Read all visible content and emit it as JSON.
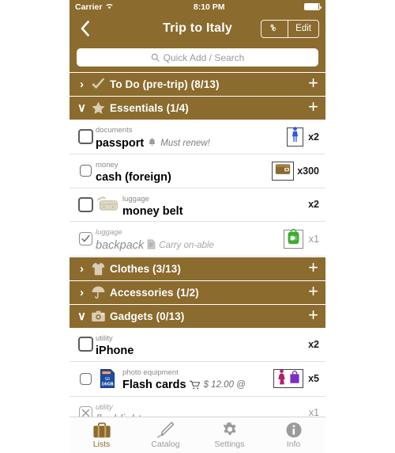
{
  "status_bar": {
    "carrier": "Carrier",
    "wifi_icon": "wifi-icon",
    "time": "8:10 PM",
    "battery_icon": "battery-icon"
  },
  "nav_bar": {
    "back_icon": "chevron-left-icon",
    "title": "Trip to Italy",
    "settings_icon": "gear-icon",
    "edit_label": "Edit"
  },
  "search": {
    "icon": "search-icon",
    "placeholder": "Quick Add / Search"
  },
  "colors": {
    "brand_brown": "#8B6B2E",
    "person_blue": "#2a5bd7",
    "woman_magenta": "#b51f6e",
    "bag_purple": "#7b2fc4",
    "backpack_green": "#3faa32",
    "wallet_brown": "#8a6a33"
  },
  "sections": [
    {
      "id": "to-do",
      "title": "To Do (pre-trip) (8/13)",
      "icon": "checkmark-icon",
      "expanded": false,
      "chevron": "›",
      "add_label": "+",
      "items": []
    },
    {
      "id": "essentials",
      "title": "Essentials (1/4)",
      "icon": "star-icon",
      "expanded": true,
      "chevron": "∨",
      "add_label": "+",
      "items": [
        {
          "category": "documents",
          "name": "passport",
          "note": "Must renew!",
          "note_icon": "bell-icon",
          "qty": "x2",
          "checkbox": "unchecked-large",
          "thumb": "none",
          "tail_icons": [
            "person-icon"
          ],
          "tail_boxed": true,
          "done": false
        },
        {
          "category": "money",
          "name": "cash (foreign)",
          "note": "",
          "note_icon": "",
          "qty": "x300",
          "checkbox": "unchecked-small",
          "thumb": "none",
          "tail_icons": [
            "wallet-icon"
          ],
          "tail_boxed": true,
          "done": false
        },
        {
          "category": "luggage",
          "name": "money belt",
          "note": "",
          "note_icon": "",
          "qty": "x2",
          "checkbox": "unchecked-large",
          "thumb": "money-belt-photo",
          "tail_icons": [],
          "tail_boxed": false,
          "done": false
        },
        {
          "category": "luggage",
          "name": "backpack",
          "note": "Carry on-able",
          "note_icon": "document-icon",
          "qty": "x1",
          "checkbox": "checked",
          "thumb": "none",
          "tail_icons": [
            "backpack-icon"
          ],
          "tail_boxed": true,
          "done": true
        }
      ]
    },
    {
      "id": "clothes",
      "title": "Clothes (3/13)",
      "icon": "tshirt-icon",
      "expanded": false,
      "chevron": "›",
      "add_label": "+",
      "items": []
    },
    {
      "id": "accessories",
      "title": "Accessories (1/2)",
      "icon": "umbrella-icon",
      "expanded": false,
      "chevron": "›",
      "add_label": "+",
      "items": []
    },
    {
      "id": "gadgets",
      "title": "Gadgets (0/13)",
      "icon": "camera-icon",
      "expanded": true,
      "chevron": "∨",
      "add_label": "+",
      "items": [
        {
          "category": "utility",
          "name": "iPhone",
          "note": "",
          "note_icon": "",
          "qty": "x2",
          "checkbox": "unchecked-large",
          "thumb": "none",
          "tail_icons": [],
          "tail_boxed": false,
          "done": false
        },
        {
          "category": "photo equipment",
          "name": "Flash cards",
          "note": "$ 12.00 @",
          "note_icon": "cart-icon",
          "qty": "x5",
          "checkbox": "unchecked-small",
          "thumb": "sd-card-photo",
          "tail_icons": [
            "woman-icon",
            "shopping-bag-icon"
          ],
          "tail_boxed": true,
          "done": false
        },
        {
          "category": "utility",
          "name": "flashlight",
          "note": "",
          "note_icon": "",
          "qty": "x1",
          "checkbox": "excluded",
          "thumb": "none",
          "tail_icons": [],
          "tail_boxed": false,
          "done": true
        }
      ]
    }
  ],
  "tab_bar": {
    "tabs": [
      {
        "id": "lists",
        "label": "Lists",
        "icon": "suitcase-icon",
        "active": true
      },
      {
        "id": "catalog",
        "label": "Catalog",
        "icon": "pencil-icon",
        "active": false
      },
      {
        "id": "settings",
        "label": "Settings",
        "icon": "gear-icon",
        "active": false
      },
      {
        "id": "info",
        "label": "Info",
        "icon": "info-icon",
        "active": false
      }
    ]
  }
}
